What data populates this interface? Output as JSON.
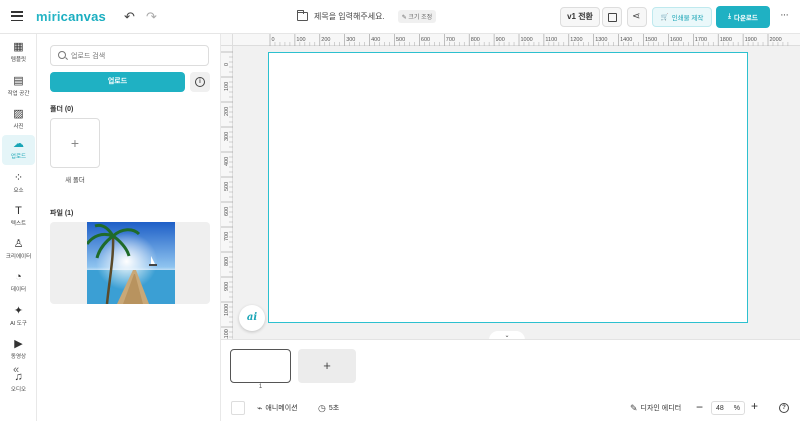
{
  "app": {
    "logo_part1": "miri",
    "logo_part2": "canvas",
    "doc_title": "제목을 입력해주세요.",
    "resize_label": "크기 조정",
    "version_label": "v1 전환",
    "print_label": "인쇄물 제작",
    "download_label": "다운로드",
    "accent_color": "#1fb1c3"
  },
  "rail": {
    "items": [
      {
        "label": "템플릿",
        "icon": "template-icon",
        "glyph": "▦"
      },
      {
        "label": "작업 공간",
        "icon": "workspace-icon",
        "glyph": "▤"
      },
      {
        "label": "사진",
        "icon": "photo-icon",
        "glyph": "▨"
      },
      {
        "label": "업로드",
        "icon": "upload-cloud-icon",
        "glyph": "☁",
        "active": true
      },
      {
        "label": "요소",
        "icon": "elements-icon",
        "glyph": "⁘"
      },
      {
        "label": "텍스트",
        "icon": "text-icon",
        "glyph": "T"
      },
      {
        "label": "크리에이터",
        "icon": "creator-icon",
        "glyph": "♙"
      },
      {
        "label": "데이터",
        "icon": "data-chart-icon",
        "glyph": "◔"
      },
      {
        "label": "AI 도구",
        "icon": "ai-sparkle-icon",
        "glyph": "✦"
      },
      {
        "label": "동영상",
        "icon": "video-icon",
        "glyph": "▶"
      },
      {
        "label": "오디오",
        "icon": "audio-icon",
        "glyph": "♫"
      }
    ]
  },
  "panel": {
    "search_placeholder": "업로드 검색",
    "upload_button": "업로드",
    "folders_heading": "폴더 (0)",
    "new_folder_label": "새 폴더",
    "files_heading": "파일 (1)"
  },
  "ruler": {
    "top_labels": [
      "0",
      "100",
      "200",
      "300",
      "400",
      "500",
      "600",
      "700",
      "800",
      "900",
      "1000",
      "1100",
      "1200",
      "1300",
      "1400",
      "1500",
      "1600",
      "1700",
      "1800",
      "1900",
      "2000"
    ],
    "left_labels": [
      "0",
      "100",
      "200",
      "300",
      "400",
      "500",
      "600",
      "700",
      "800",
      "900",
      "1000",
      "1100"
    ]
  },
  "workspace": {
    "ai_button_label": "ai"
  },
  "pages": {
    "page_number": "1"
  },
  "bottombar": {
    "animation_label": "애니메이션",
    "duration_label": "5초",
    "design_editor_label": "디자인 에디터",
    "zoom_value": "48",
    "zoom_unit": "%"
  }
}
